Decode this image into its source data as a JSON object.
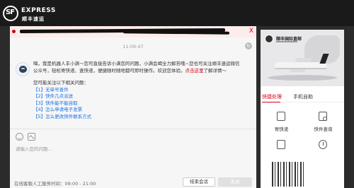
{
  "brand": {
    "logo_mark": "SF",
    "name_en": "EXPRESS",
    "name_cn": "顺丰速运"
  },
  "notice": {
    "close_label": "X"
  },
  "chat": {
    "timestamp": "11:06:47",
    "bot_message": "嗨，我是机器人丰小满～您可直接告诉小满您的问题，小满会竭全力解答哦~您也可关注顺丰速运微信公众号，轻松寄快递、查快递，便捷随时随地都可即时操作。欢迎您体验。",
    "bot_link": "点击这里",
    "bot_message_tail": "了解详情～",
    "related_title": "您可能关注以下相关问题：",
    "related_questions": [
      "【1】无单号查件",
      "【2】快件几点派送",
      "【3】快件能不能自取",
      "【4】怎么申请电子发票",
      "【5】怎么更改快件联系方式"
    ]
  },
  "input": {
    "placeholder": "请输入您的问题..."
  },
  "footer": {
    "hours_text": "在线客服人工服务时间：09:00 - 21:00",
    "end_button": "结束会话",
    "send_button": "发送"
  },
  "sidebar": {
    "banner_title": "顺丰国际直邮",
    "tabs": [
      "快捷处理",
      "手机自助"
    ],
    "quick_items": [
      {
        "label": "寄快递",
        "icon": "package-icon"
      },
      {
        "label": "快件查询",
        "icon": "search-doc-icon"
      },
      {
        "label": "",
        "icon": "inbox-icon"
      },
      {
        "label": "",
        "icon": "clock-icon"
      }
    ]
  },
  "colors": {
    "brand_red": "#d0021b",
    "link_blue": "#1a73e8",
    "header_bg": "#1a1a1a"
  }
}
